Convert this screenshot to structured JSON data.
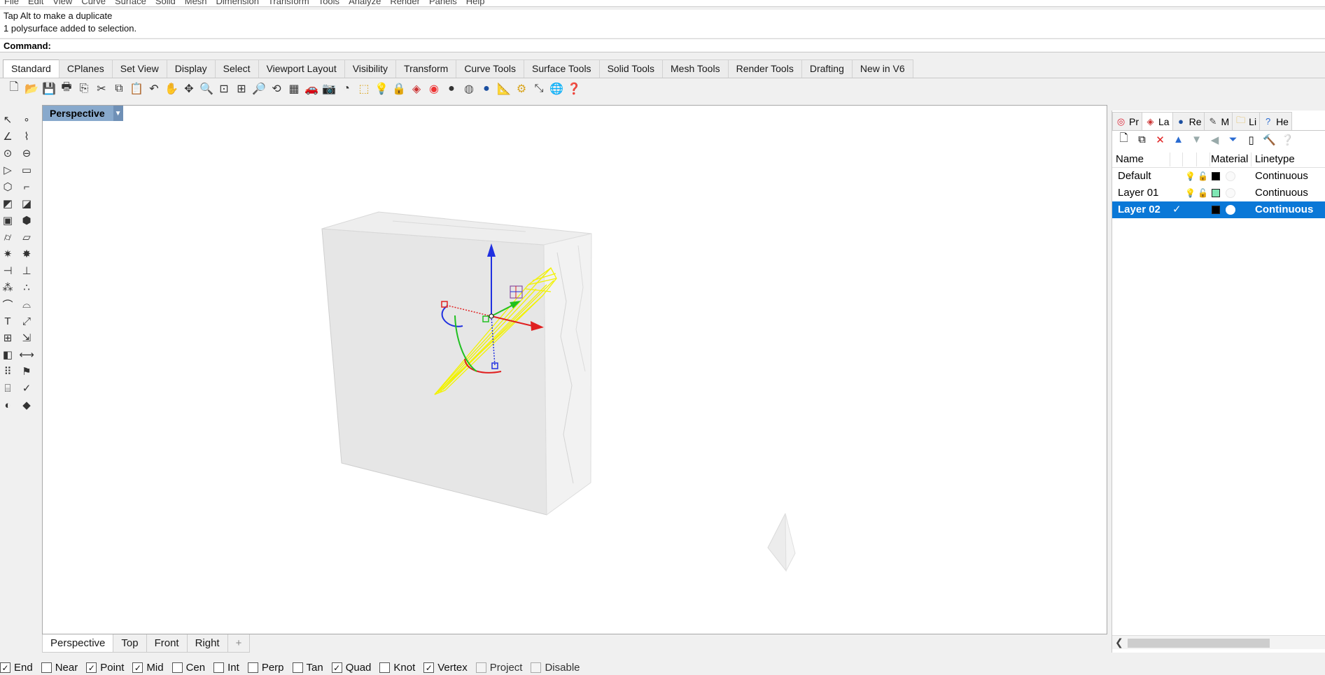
{
  "menubar": {
    "items": [
      "File",
      "Edit",
      "View",
      "Curve",
      "Surface",
      "Solid",
      "Mesh",
      "Dimension",
      "Transform",
      "Tools",
      "Analyze",
      "Render",
      "Panels",
      "Help"
    ]
  },
  "command_history": {
    "lines": [
      "Tap Alt to make a duplicate",
      "1 polysurface added to selection."
    ]
  },
  "command_prompt": "Command:",
  "toolbar_tabs": [
    "Standard",
    "CPlanes",
    "Set View",
    "Display",
    "Select",
    "Viewport Layout",
    "Visibility",
    "Transform",
    "Curve Tools",
    "Surface Tools",
    "Solid Tools",
    "Mesh Tools",
    "Render Tools",
    "Drafting",
    "New in V6"
  ],
  "active_toolbar_tab": "Standard",
  "viewport": {
    "title": "Perspective"
  },
  "viewport_tabs": [
    "Perspective",
    "Top",
    "Front",
    "Right"
  ],
  "add_viewport_tab_icon": "plus-icon",
  "osnaps": [
    {
      "label": "End",
      "checked": true
    },
    {
      "label": "Near",
      "checked": false
    },
    {
      "label": "Point",
      "checked": true
    },
    {
      "label": "Mid",
      "checked": true
    },
    {
      "label": "Cen",
      "checked": false
    },
    {
      "label": "Int",
      "checked": false
    },
    {
      "label": "Perp",
      "checked": false
    },
    {
      "label": "Tan",
      "checked": false
    },
    {
      "label": "Quad",
      "checked": true
    },
    {
      "label": "Knot",
      "checked": false
    },
    {
      "label": "Vertex",
      "checked": true
    },
    {
      "label": "Project",
      "checked": false,
      "disabled": true
    },
    {
      "label": "Disable",
      "checked": false,
      "disabled": true
    }
  ],
  "panel_tabs": [
    {
      "label": "Pr",
      "icon": "properties-icon"
    },
    {
      "label": "La",
      "icon": "layers-icon"
    },
    {
      "label": "Re",
      "icon": "render-icon"
    },
    {
      "label": "M",
      "icon": "materials-icon"
    },
    {
      "label": "Li",
      "icon": "libraries-icon"
    },
    {
      "label": "He",
      "icon": "help-icon"
    }
  ],
  "layers": {
    "columns": [
      "Name",
      "Material",
      "Linetype"
    ],
    "rows": [
      {
        "name": "Default",
        "current": false,
        "color": "#000000",
        "linetype": "Continuous"
      },
      {
        "name": "Layer 01",
        "current": false,
        "color": "#7fe6b4",
        "linetype": "Continuous"
      },
      {
        "name": "Layer 02",
        "current": true,
        "color": "#000000",
        "linetype": "Continuous"
      }
    ]
  },
  "colors": {
    "selection": "#0a78d7",
    "viewport_title_bg": "#88a9cc",
    "gumball_x": "#e02020",
    "gumball_y": "#20c020",
    "gumball_z": "#2030e0",
    "selected_object": "#f2f200"
  }
}
